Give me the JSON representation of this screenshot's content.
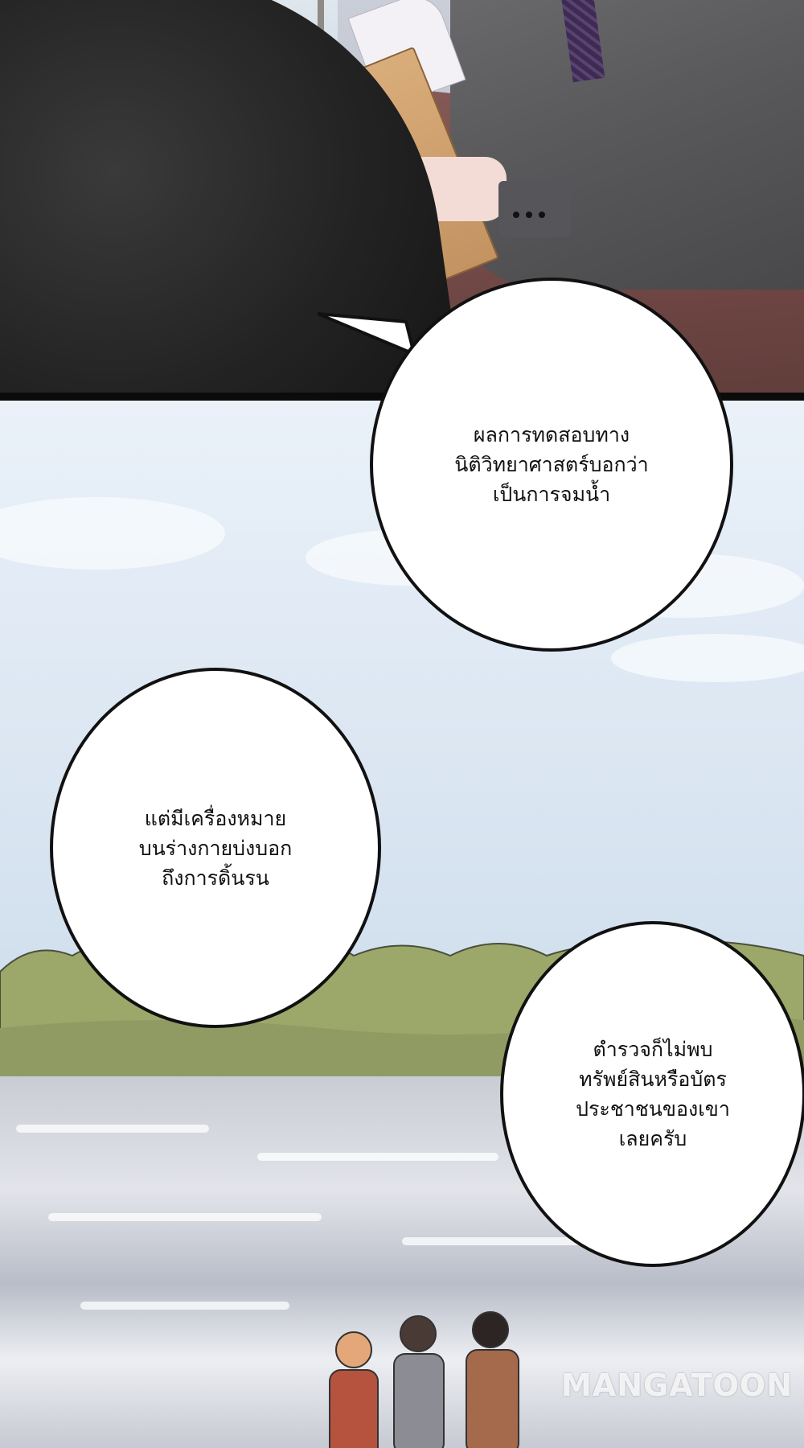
{
  "bubbles": [
    {
      "lines": [
        "ผลการทดสอบทาง",
        "นิติวิทยาศาสตร์บอกว่า",
        "เป็นการจมน้ำ"
      ]
    },
    {
      "lines": [
        "แต่มีเครื่องหมาย",
        "บนร่างกายบ่งบอก",
        "ถึงการดิ้นรน"
      ]
    },
    {
      "lines": [
        "ตำรวจก็ไม่พบ",
        "ทรัพย์สินหรือบัตร",
        "ประชาชนของเขา",
        "เลยครับ"
      ]
    }
  ],
  "watermark": "MANGATOON"
}
